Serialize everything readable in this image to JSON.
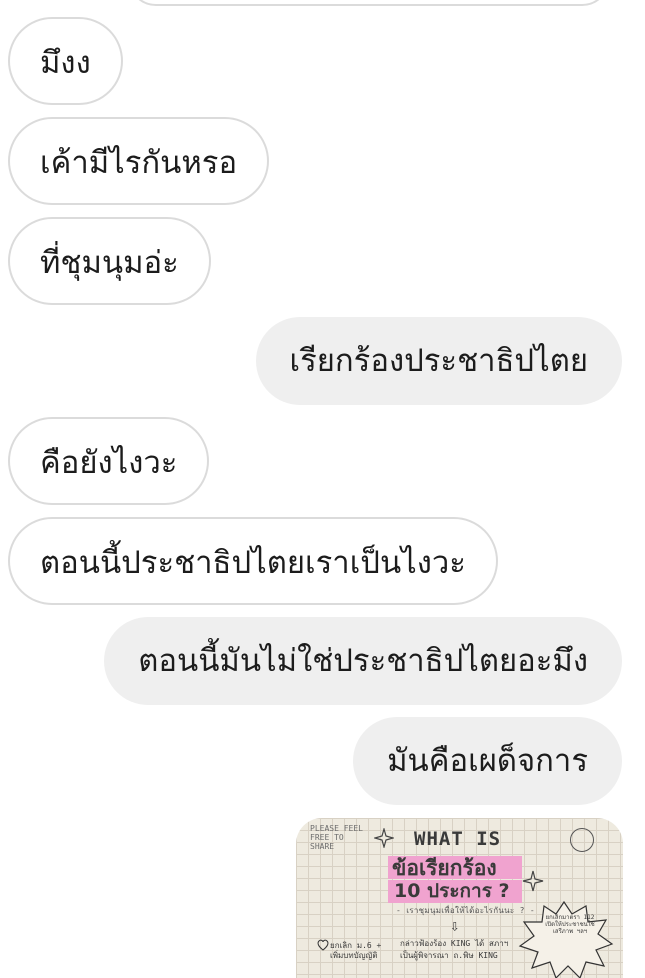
{
  "messages": [
    {
      "side": "in",
      "text": "มึงง"
    },
    {
      "side": "in",
      "text": "เค้ามีไรกันหรอ"
    },
    {
      "side": "in",
      "text": "ที่ชุมนุมอ่ะ"
    },
    {
      "side": "out",
      "text": "เรียกร้องประชาธิปไตย"
    },
    {
      "side": "in",
      "text": "คือยังไงวะ"
    },
    {
      "side": "in",
      "text": "ตอนนี้ประชาธิปไตยเราเป็นไงวะ"
    },
    {
      "side": "out",
      "text": "ตอนนี้มันไม่ใช่ประชาธิปไตยอะมึง"
    },
    {
      "side": "out",
      "text": "มันคือเผด็จการ"
    }
  ],
  "image_message": {
    "corner_note": "PLEASE FEEL FREE TO SHARE",
    "title": "WHAT IS",
    "line1": "ข้อเรียกร้อง",
    "line2": "10 ประการ ?",
    "subtitle": "- เราชุมนุมเพื่อให้ได้อะไรกันนะ ? -",
    "left_note": "ยกเลิก ม.6 + เพิ่มบทบัญญัติ",
    "mid_note": "กล่าวฟ้องร้อง KING ได้ สภาฯ เป็นผู้พิจารณา ถ.พิษ KING",
    "burst_note": "ยกเลิกมาตรา 112 เปิดให้ประชาชนใช้เสรีภาพ ฯลฯ"
  },
  "colors": {
    "incoming_border": "#dbdbdb",
    "outgoing_fill": "#efefef",
    "highlight_pink": "#f0a3cf",
    "paper": "#eeeadf"
  }
}
